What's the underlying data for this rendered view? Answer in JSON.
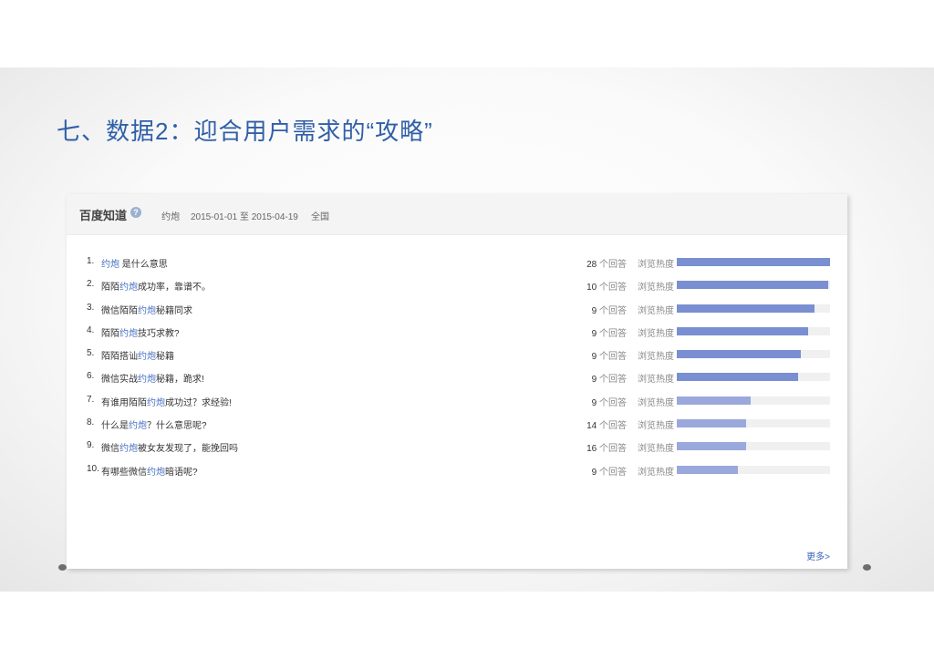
{
  "slide": {
    "title": "七、数据2：迎合用户需求的“攻略”"
  },
  "panel": {
    "brand": "百度知道",
    "help_icon": "?",
    "keyword": "约炮",
    "date_range": "2015-01-01 至 2015-04-19",
    "region": "全国",
    "more_label": "更多>",
    "answers_unit": "个回答",
    "heat_label": "浏览热度",
    "colors": {
      "bar_dark": "#7a8fd1",
      "bar_light": "#9aa8db",
      "keyword": "#4a72c2"
    },
    "rows": [
      {
        "num": "1.",
        "pre": "",
        "kw": "约炮",
        "post": " 是什么意思",
        "count": "28",
        "heat": 1.0
      },
      {
        "num": "2.",
        "pre": "陌陌",
        "kw": "约炮",
        "post": "成功率，靠谱不。",
        "count": "10",
        "heat": 0.99
      },
      {
        "num": "3.",
        "pre": "微信陌陌",
        "kw": "约炮",
        "post": "秘籍同求",
        "count": "9",
        "heat": 0.9
      },
      {
        "num": "4.",
        "pre": "陌陌",
        "kw": "约炮",
        "post": "技巧求教?",
        "count": "9",
        "heat": 0.86
      },
      {
        "num": "5.",
        "pre": "陌陌搭讪",
        "kw": "约炮",
        "post": "秘籍",
        "count": "9",
        "heat": 0.81
      },
      {
        "num": "6.",
        "pre": "微信实战",
        "kw": "约炮",
        "post": "秘籍，跪求!",
        "count": "9",
        "heat": 0.79
      },
      {
        "num": "7.",
        "pre": "有谁用陌陌",
        "kw": "约炮",
        "post": "成功过？求经验!",
        "count": "9",
        "heat": 0.48
      },
      {
        "num": "8.",
        "pre": "什么是",
        "kw": "约炮",
        "post": "？什么意思呢?",
        "count": "14",
        "heat": 0.45
      },
      {
        "num": "9.",
        "pre": "微信",
        "kw": "约炮",
        "post": "被女友发现了，能挽回吗",
        "count": "16",
        "heat": 0.45
      },
      {
        "num": "10.",
        "pre": "有哪些微信",
        "kw": "约炮",
        "post": "暗语呢?",
        "count": "9",
        "heat": 0.4
      }
    ]
  }
}
